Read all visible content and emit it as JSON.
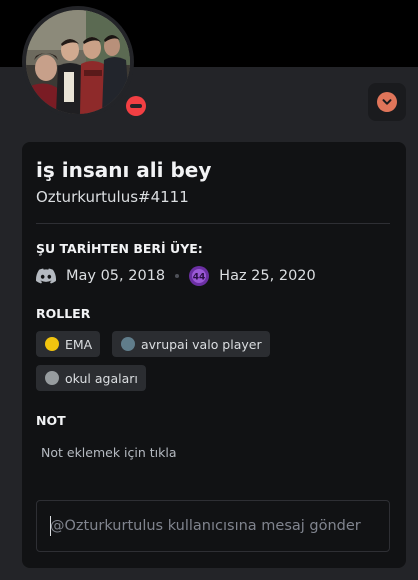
{
  "profile": {
    "display_name": "iş insanı ali bey",
    "username": "Ozturkurtulus#4111",
    "status": "do-not-disturb",
    "avatar_icon": "group-photo-avatar"
  },
  "member_since": {
    "title": "ŞU TARİHTEN BERİ ÜYE:",
    "discord_icon": "discord-icon",
    "discord_date": "May 05, 2018",
    "server_icon": "server-icon",
    "server_date": "Haz 25, 2020"
  },
  "roles": {
    "title": "ROLLER",
    "items": [
      {
        "label": "EMA",
        "color": "#f1c40f"
      },
      {
        "label": "avrupai valo player",
        "color": "#607d8b"
      },
      {
        "label": "okul agaları",
        "color": "#979c9f"
      }
    ]
  },
  "note": {
    "title": "NOT",
    "placeholder": "Not eklemek için tıkla"
  },
  "message": {
    "placeholder": "@Ozturkurtulus kullanıcısına mesaj gönder"
  },
  "colors": {
    "background": "#232428",
    "card": "#111214",
    "banner": "#000000",
    "dnd": "#f23f43",
    "badge": "#e0755a"
  }
}
